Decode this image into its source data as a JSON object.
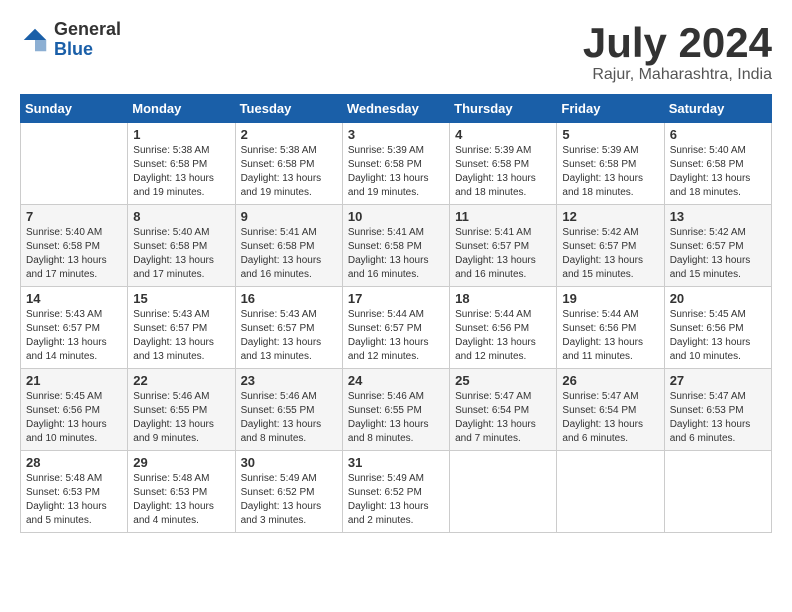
{
  "logo": {
    "general": "General",
    "blue": "Blue"
  },
  "title": {
    "month_year": "July 2024",
    "location": "Rajur, Maharashtra, India"
  },
  "headers": [
    "Sunday",
    "Monday",
    "Tuesday",
    "Wednesday",
    "Thursday",
    "Friday",
    "Saturday"
  ],
  "weeks": [
    [
      {
        "day": "",
        "info": ""
      },
      {
        "day": "1",
        "info": "Sunrise: 5:38 AM\nSunset: 6:58 PM\nDaylight: 13 hours\nand 19 minutes."
      },
      {
        "day": "2",
        "info": "Sunrise: 5:38 AM\nSunset: 6:58 PM\nDaylight: 13 hours\nand 19 minutes."
      },
      {
        "day": "3",
        "info": "Sunrise: 5:39 AM\nSunset: 6:58 PM\nDaylight: 13 hours\nand 19 minutes."
      },
      {
        "day": "4",
        "info": "Sunrise: 5:39 AM\nSunset: 6:58 PM\nDaylight: 13 hours\nand 18 minutes."
      },
      {
        "day": "5",
        "info": "Sunrise: 5:39 AM\nSunset: 6:58 PM\nDaylight: 13 hours\nand 18 minutes."
      },
      {
        "day": "6",
        "info": "Sunrise: 5:40 AM\nSunset: 6:58 PM\nDaylight: 13 hours\nand 18 minutes."
      }
    ],
    [
      {
        "day": "7",
        "info": "Sunrise: 5:40 AM\nSunset: 6:58 PM\nDaylight: 13 hours\nand 17 minutes."
      },
      {
        "day": "8",
        "info": "Sunrise: 5:40 AM\nSunset: 6:58 PM\nDaylight: 13 hours\nand 17 minutes."
      },
      {
        "day": "9",
        "info": "Sunrise: 5:41 AM\nSunset: 6:58 PM\nDaylight: 13 hours\nand 16 minutes."
      },
      {
        "day": "10",
        "info": "Sunrise: 5:41 AM\nSunset: 6:58 PM\nDaylight: 13 hours\nand 16 minutes."
      },
      {
        "day": "11",
        "info": "Sunrise: 5:41 AM\nSunset: 6:57 PM\nDaylight: 13 hours\nand 16 minutes."
      },
      {
        "day": "12",
        "info": "Sunrise: 5:42 AM\nSunset: 6:57 PM\nDaylight: 13 hours\nand 15 minutes."
      },
      {
        "day": "13",
        "info": "Sunrise: 5:42 AM\nSunset: 6:57 PM\nDaylight: 13 hours\nand 15 minutes."
      }
    ],
    [
      {
        "day": "14",
        "info": "Sunrise: 5:43 AM\nSunset: 6:57 PM\nDaylight: 13 hours\nand 14 minutes."
      },
      {
        "day": "15",
        "info": "Sunrise: 5:43 AM\nSunset: 6:57 PM\nDaylight: 13 hours\nand 13 minutes."
      },
      {
        "day": "16",
        "info": "Sunrise: 5:43 AM\nSunset: 6:57 PM\nDaylight: 13 hours\nand 13 minutes."
      },
      {
        "day": "17",
        "info": "Sunrise: 5:44 AM\nSunset: 6:57 PM\nDaylight: 13 hours\nand 12 minutes."
      },
      {
        "day": "18",
        "info": "Sunrise: 5:44 AM\nSunset: 6:56 PM\nDaylight: 13 hours\nand 12 minutes."
      },
      {
        "day": "19",
        "info": "Sunrise: 5:44 AM\nSunset: 6:56 PM\nDaylight: 13 hours\nand 11 minutes."
      },
      {
        "day": "20",
        "info": "Sunrise: 5:45 AM\nSunset: 6:56 PM\nDaylight: 13 hours\nand 10 minutes."
      }
    ],
    [
      {
        "day": "21",
        "info": "Sunrise: 5:45 AM\nSunset: 6:56 PM\nDaylight: 13 hours\nand 10 minutes."
      },
      {
        "day": "22",
        "info": "Sunrise: 5:46 AM\nSunset: 6:55 PM\nDaylight: 13 hours\nand 9 minutes."
      },
      {
        "day": "23",
        "info": "Sunrise: 5:46 AM\nSunset: 6:55 PM\nDaylight: 13 hours\nand 8 minutes."
      },
      {
        "day": "24",
        "info": "Sunrise: 5:46 AM\nSunset: 6:55 PM\nDaylight: 13 hours\nand 8 minutes."
      },
      {
        "day": "25",
        "info": "Sunrise: 5:47 AM\nSunset: 6:54 PM\nDaylight: 13 hours\nand 7 minutes."
      },
      {
        "day": "26",
        "info": "Sunrise: 5:47 AM\nSunset: 6:54 PM\nDaylight: 13 hours\nand 6 minutes."
      },
      {
        "day": "27",
        "info": "Sunrise: 5:47 AM\nSunset: 6:53 PM\nDaylight: 13 hours\nand 6 minutes."
      }
    ],
    [
      {
        "day": "28",
        "info": "Sunrise: 5:48 AM\nSunset: 6:53 PM\nDaylight: 13 hours\nand 5 minutes."
      },
      {
        "day": "29",
        "info": "Sunrise: 5:48 AM\nSunset: 6:53 PM\nDaylight: 13 hours\nand 4 minutes."
      },
      {
        "day": "30",
        "info": "Sunrise: 5:49 AM\nSunset: 6:52 PM\nDaylight: 13 hours\nand 3 minutes."
      },
      {
        "day": "31",
        "info": "Sunrise: 5:49 AM\nSunset: 6:52 PM\nDaylight: 13 hours\nand 2 minutes."
      },
      {
        "day": "",
        "info": ""
      },
      {
        "day": "",
        "info": ""
      },
      {
        "day": "",
        "info": ""
      }
    ]
  ]
}
